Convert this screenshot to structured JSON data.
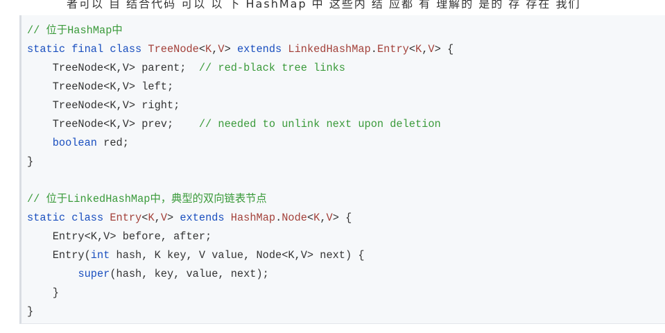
{
  "page": {
    "top_text_partial": "者可以 目  结合代码 可以  以 下  HashMap 中 这些内 结 应都 有 理解的 是的 存 存在 我们"
  },
  "code": {
    "lines": [
      [
        {
          "t": "// 位于HashMap中",
          "c": "c"
        }
      ],
      [
        {
          "t": "static final class ",
          "c": "k"
        },
        {
          "t": "TreeNode",
          "c": "t"
        },
        {
          "t": "<",
          "c": "n"
        },
        {
          "t": "K",
          "c": "t"
        },
        {
          "t": ",",
          "c": "n"
        },
        {
          "t": "V",
          "c": "t"
        },
        {
          "t": "> ",
          "c": "n"
        },
        {
          "t": "extends ",
          "c": "k"
        },
        {
          "t": "LinkedHashMap",
          "c": "t"
        },
        {
          "t": ".",
          "c": "n"
        },
        {
          "t": "Entry",
          "c": "t"
        },
        {
          "t": "<",
          "c": "n"
        },
        {
          "t": "K",
          "c": "t"
        },
        {
          "t": ",",
          "c": "n"
        },
        {
          "t": "V",
          "c": "t"
        },
        {
          "t": "> {",
          "c": "n"
        }
      ],
      [
        {
          "t": "    TreeNode<K,V> parent;  ",
          "c": "n"
        },
        {
          "t": "// red-black tree links",
          "c": "c"
        }
      ],
      [
        {
          "t": "    TreeNode<K,V> left;",
          "c": "n"
        }
      ],
      [
        {
          "t": "    TreeNode<K,V> right;",
          "c": "n"
        }
      ],
      [
        {
          "t": "    TreeNode<K,V> prev;    ",
          "c": "n"
        },
        {
          "t": "// needed to unlink next upon deletion",
          "c": "c"
        }
      ],
      [
        {
          "t": "    ",
          "c": "n"
        },
        {
          "t": "boolean",
          "c": "k"
        },
        {
          "t": " red;",
          "c": "n"
        }
      ],
      [
        {
          "t": "}",
          "c": "n"
        }
      ],
      [
        {
          "t": "",
          "c": "n"
        }
      ],
      [
        {
          "t": "// 位于LinkedHashMap中，典型的双向链表节点",
          "c": "c"
        }
      ],
      [
        {
          "t": "static class ",
          "c": "k"
        },
        {
          "t": "Entry",
          "c": "t"
        },
        {
          "t": "<",
          "c": "n"
        },
        {
          "t": "K",
          "c": "t"
        },
        {
          "t": ",",
          "c": "n"
        },
        {
          "t": "V",
          "c": "t"
        },
        {
          "t": "> ",
          "c": "n"
        },
        {
          "t": "extends ",
          "c": "k"
        },
        {
          "t": "HashMap",
          "c": "t"
        },
        {
          "t": ".",
          "c": "n"
        },
        {
          "t": "Node",
          "c": "t"
        },
        {
          "t": "<",
          "c": "n"
        },
        {
          "t": "K",
          "c": "t"
        },
        {
          "t": ",",
          "c": "n"
        },
        {
          "t": "V",
          "c": "t"
        },
        {
          "t": "> {",
          "c": "n"
        }
      ],
      [
        {
          "t": "    Entry<K,V> before, after;",
          "c": "n"
        }
      ],
      [
        {
          "t": "    Entry(",
          "c": "n"
        },
        {
          "t": "int",
          "c": "k"
        },
        {
          "t": " hash, K key, V value, Node<K,V> next) {",
          "c": "n"
        }
      ],
      [
        {
          "t": "        ",
          "c": "n"
        },
        {
          "t": "super",
          "c": "k"
        },
        {
          "t": "(hash, key, value, next);",
          "c": "n"
        }
      ],
      [
        {
          "t": "    }",
          "c": "n"
        }
      ],
      [
        {
          "t": "}",
          "c": "n"
        }
      ]
    ]
  },
  "colors": {
    "comment": "#3a9a3a",
    "keyword": "#1a4fbf",
    "type": "#a3413a",
    "plain": "#333333",
    "background": "#f6f8fa"
  }
}
